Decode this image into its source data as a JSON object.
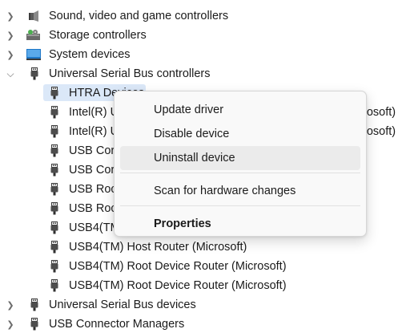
{
  "tree": {
    "sound_label": "Sound, video and game controllers",
    "storage_label": "Storage controllers",
    "system_label": "System devices",
    "usb_controllers_label": "Universal Serial Bus controllers",
    "children": [
      "HTRA Devices",
      "Intel(R) U",
      "Intel(R) U",
      "USB Cor",
      "USB Cor",
      "USB Roc",
      "USB Roc",
      "USB4(TM",
      "USB4(TM) Host Router (Microsoft)",
      "USB4(TM) Root Device Router (Microsoft)",
      "USB4(TM) Root Device Router (Microsoft)"
    ],
    "intel_suffix_1": "rosoft)",
    "intel_suffix_2": "rosoft)",
    "usb_devices_label": "Universal Serial Bus devices",
    "usb_connector_label": "USB Connector Managers"
  },
  "context_menu": {
    "update_driver": "Update driver",
    "disable_device": "Disable device",
    "uninstall_device": "Uninstall device",
    "scan_hardware": "Scan for hardware changes",
    "properties": "Properties"
  },
  "colors": {
    "selection": "#dbe8f8",
    "menu_hover": "#ebebeb",
    "menu_bg": "#f9f9f9"
  },
  "icons": {
    "collapsed": "chevron-right-icon",
    "expanded": "chevron-down-icon",
    "sound": "speaker-icon",
    "storage": "storage-controller-icon",
    "system": "system-devices-icon",
    "usb": "usb-plug-icon"
  }
}
